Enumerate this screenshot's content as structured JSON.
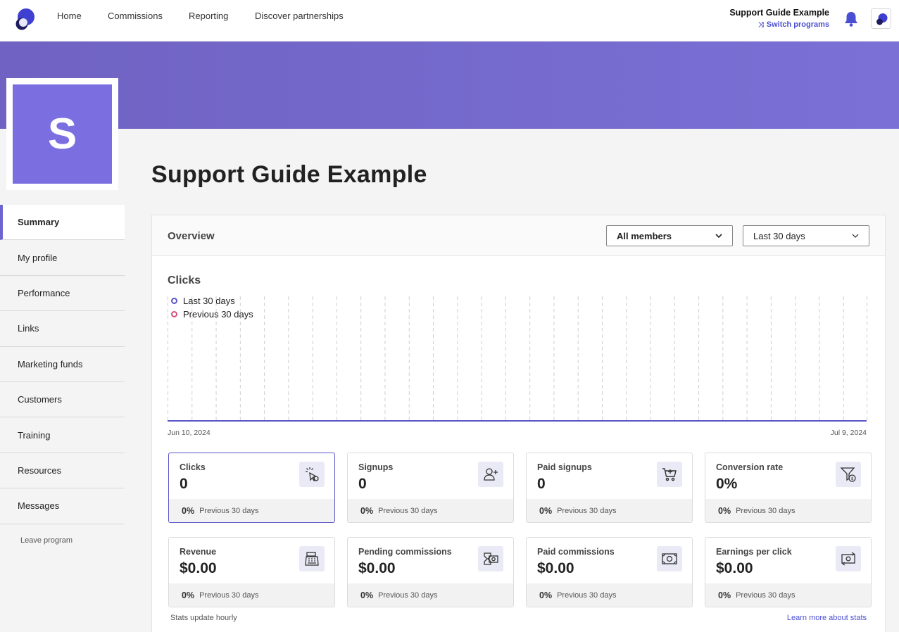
{
  "nav": {
    "links": [
      "Home",
      "Commissions",
      "Reporting",
      "Discover partnerships"
    ],
    "program_name": "Support Guide Example",
    "switch_label": "Switch programs"
  },
  "colors": {
    "accent": "#6e64d1",
    "link": "#4a4fd1",
    "banner": "#7a70d6"
  },
  "tile_letter": "S",
  "page_title": "Support Guide Example",
  "sidebar": {
    "items": [
      "Summary",
      "My profile",
      "Performance",
      "Links",
      "Marketing funds",
      "Customers",
      "Training",
      "Resources",
      "Messages"
    ],
    "active": "Summary",
    "leave": "Leave program"
  },
  "overview": {
    "title": "Overview",
    "member_filter": "All members",
    "range_filter": "Last 30 days"
  },
  "chart_data": {
    "type": "line",
    "title": "Clicks",
    "x_start": "Jun 10, 2024",
    "x_end": "Jul 9, 2024",
    "grid": "vertical dashed",
    "legend_placement": "top-left",
    "series": [
      {
        "name": "Last 30 days",
        "color": "#5a55c8",
        "values": [
          0,
          0,
          0,
          0,
          0,
          0,
          0,
          0,
          0,
          0,
          0,
          0,
          0,
          0,
          0,
          0,
          0,
          0,
          0,
          0,
          0,
          0,
          0,
          0,
          0,
          0,
          0,
          0,
          0,
          0
        ]
      },
      {
        "name": "Previous 30 days",
        "color": "#d4507a",
        "values": [
          0,
          0,
          0,
          0,
          0,
          0,
          0,
          0,
          0,
          0,
          0,
          0,
          0,
          0,
          0,
          0,
          0,
          0,
          0,
          0,
          0,
          0,
          0,
          0,
          0,
          0,
          0,
          0,
          0,
          0
        ]
      }
    ]
  },
  "stats": [
    {
      "label": "Clicks",
      "value": "0",
      "pct": "0%",
      "compare": "Previous 30 days",
      "icon": "click-icon"
    },
    {
      "label": "Signups",
      "value": "0",
      "pct": "0%",
      "compare": "Previous 30 days",
      "icon": "add-user-icon"
    },
    {
      "label": "Paid signups",
      "value": "0",
      "pct": "0%",
      "compare": "Previous 30 days",
      "icon": "cart-icon"
    },
    {
      "label": "Conversion rate",
      "value": "0%",
      "pct": "0%",
      "compare": "Previous 30 days",
      "icon": "funnel-dollar-icon"
    },
    {
      "label": "Revenue",
      "value": "$0.00",
      "pct": "0%",
      "compare": "Previous 30 days",
      "icon": "cash-register-icon"
    },
    {
      "label": "Pending commissions",
      "value": "$0.00",
      "pct": "0%",
      "compare": "Previous 30 days",
      "icon": "pending-money-icon"
    },
    {
      "label": "Paid commissions",
      "value": "$0.00",
      "pct": "0%",
      "compare": "Previous 30 days",
      "icon": "money-bill-icon"
    },
    {
      "label": "Earnings per click",
      "value": "$0.00",
      "pct": "0%",
      "compare": "Previous 30 days",
      "icon": "money-exchange-icon"
    }
  ],
  "footer": {
    "note": "Stats update hourly",
    "learn_more": "Learn more about stats"
  }
}
